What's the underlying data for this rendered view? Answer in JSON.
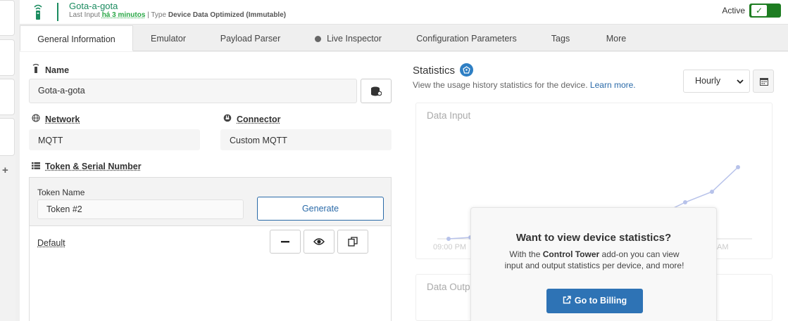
{
  "header": {
    "device_name": "Gota-a-gota",
    "last_input_label": "Last Input",
    "last_input_value": "há 3 minutos",
    "type_label": "Type",
    "type_value": "Device Data Optimized (Immutable)",
    "active_label": "Active",
    "active_on": true
  },
  "tabs": [
    {
      "label": "General Information",
      "active": true
    },
    {
      "label": "Emulator"
    },
    {
      "label": "Payload Parser"
    },
    {
      "label": "Live Inspector"
    },
    {
      "label": "Configuration Parameters"
    },
    {
      "label": "Tags"
    },
    {
      "label": "More"
    }
  ],
  "form": {
    "name_label": "Name",
    "name_value": "Gota-a-gota",
    "network_label": "Network",
    "network_value": "MQTT",
    "connector_label": "Connector",
    "connector_value": "Custom MQTT",
    "token_section_label": "Token & Serial Number",
    "token_name_label": "Token Name",
    "token_name_value": "Token #2",
    "generate_label": "Generate",
    "default_token_label": "Default"
  },
  "stats": {
    "title": "Statistics",
    "description": "View the usage history statistics for the device.",
    "learn_more": "Learn more.",
    "interval_selected": "Hourly",
    "data_input_title": "Data Input",
    "data_output_title": "Data Outp",
    "x_tick_first": "09:00 PM",
    "x_tick_last": "AM"
  },
  "upsell": {
    "title": "Want to view device statistics?",
    "text_pre": "With the ",
    "text_bold": "Control Tower",
    "text_post": " add-on you can view input and output statistics per device, and more!",
    "button_label": "Go to Billing"
  },
  "colors": {
    "brand_green": "#1a8b5f",
    "toggle_green": "#1e7d22",
    "primary_blue": "#2e73b5",
    "chart_line": "#b7c2ea"
  },
  "icons": {
    "device": "device-icon",
    "toggle_check": "checkmark-icon",
    "name": "device-small-icon",
    "name_action": "database-icon",
    "network": "globe-icon",
    "connector": "plug-icon",
    "token": "list-icon",
    "remove": "minus-icon",
    "view": "eye-icon",
    "copy": "copy-icon",
    "stats": "badge-icon",
    "calendar": "calendar-icon",
    "billing": "external-link-icon"
  }
}
